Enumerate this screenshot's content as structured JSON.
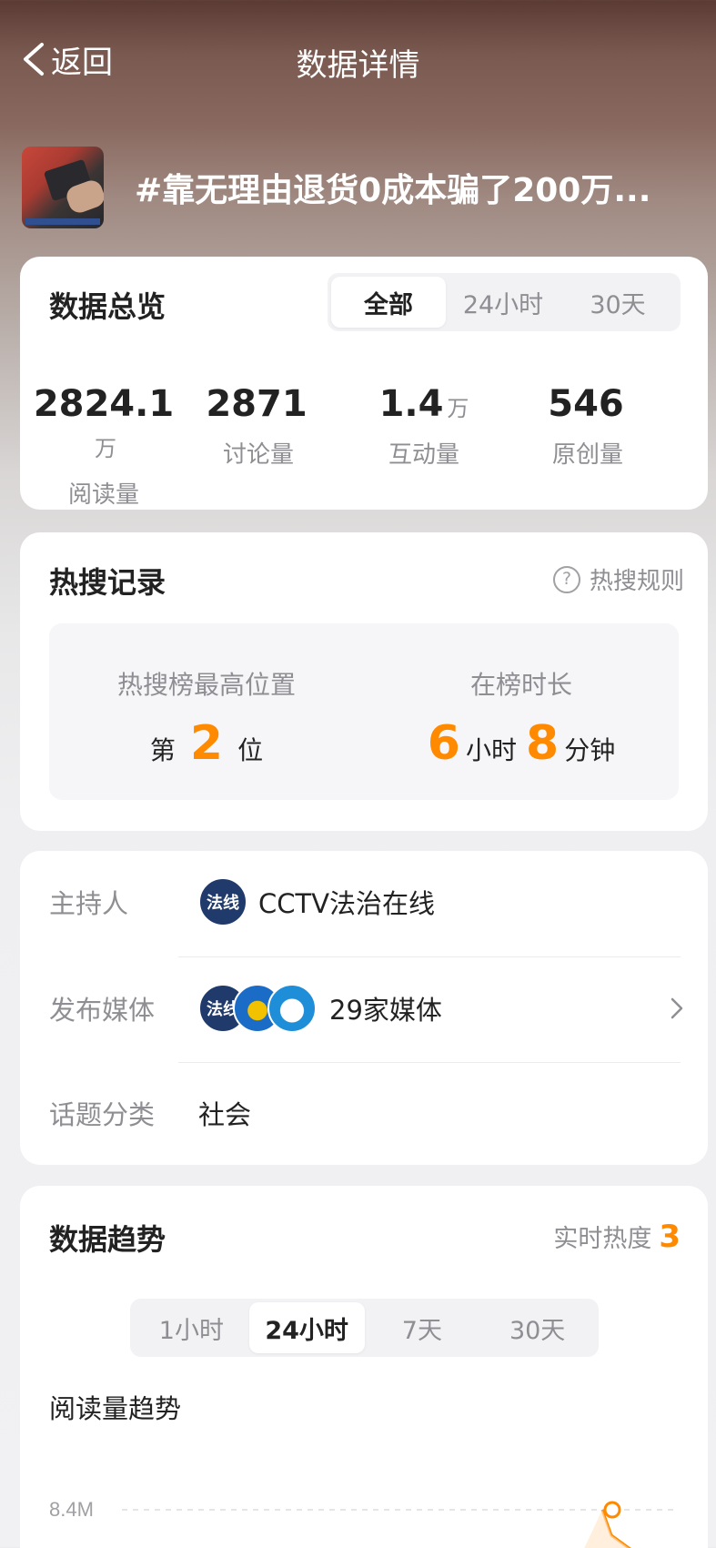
{
  "nav": {
    "back_label": "返回",
    "title": "数据详情"
  },
  "topic": {
    "title": "#靠无理由退货0成本骗了200万..."
  },
  "overview": {
    "title": "数据总览",
    "tabs": [
      "全部",
      "24小时",
      "30天"
    ],
    "active_tab": 0,
    "stats": [
      {
        "value": "2824.1",
        "unit": "万",
        "label": "阅读量"
      },
      {
        "value": "2871",
        "unit": "",
        "label": "讨论量"
      },
      {
        "value": "1.4",
        "unit": "万",
        "label": "互动量"
      },
      {
        "value": "546",
        "unit": "",
        "label": "原创量"
      }
    ]
  },
  "hot": {
    "title": "热搜记录",
    "rule_label": "热搜规则",
    "best_position_label": "热搜榜最高位置",
    "best_position_prefix": "第",
    "best_position_value": "2",
    "best_position_suffix": "位",
    "duration_label": "在榜时长",
    "duration_hours": "6",
    "duration_hours_unit": "小时",
    "duration_minutes": "8",
    "duration_minutes_unit": "分钟"
  },
  "info": {
    "host_key": "主持人",
    "host_name": "CCTV法治在线",
    "host_avatar_text": "法线",
    "media_key": "发布媒体",
    "media_value": "29家媒体",
    "category_key": "话题分类",
    "category_value": "社会"
  },
  "trend": {
    "title": "数据趋势",
    "live_heat_label": "实时热度",
    "live_heat_value": "3",
    "tabs": [
      "1小时",
      "24小时",
      "7天",
      "30天"
    ],
    "active_tab": 1,
    "chart_title": "阅读量趋势",
    "y_tick": "8.4M"
  },
  "colors": {
    "accent": "#ff8a00",
    "card": "#ffffff",
    "muted": "#8e8e93"
  },
  "chart_data": {
    "type": "line",
    "title": "阅读量趋势",
    "y_ticks": [
      "8.4M"
    ],
    "grid": true,
    "series": [
      {
        "values": []
      }
    ]
  }
}
